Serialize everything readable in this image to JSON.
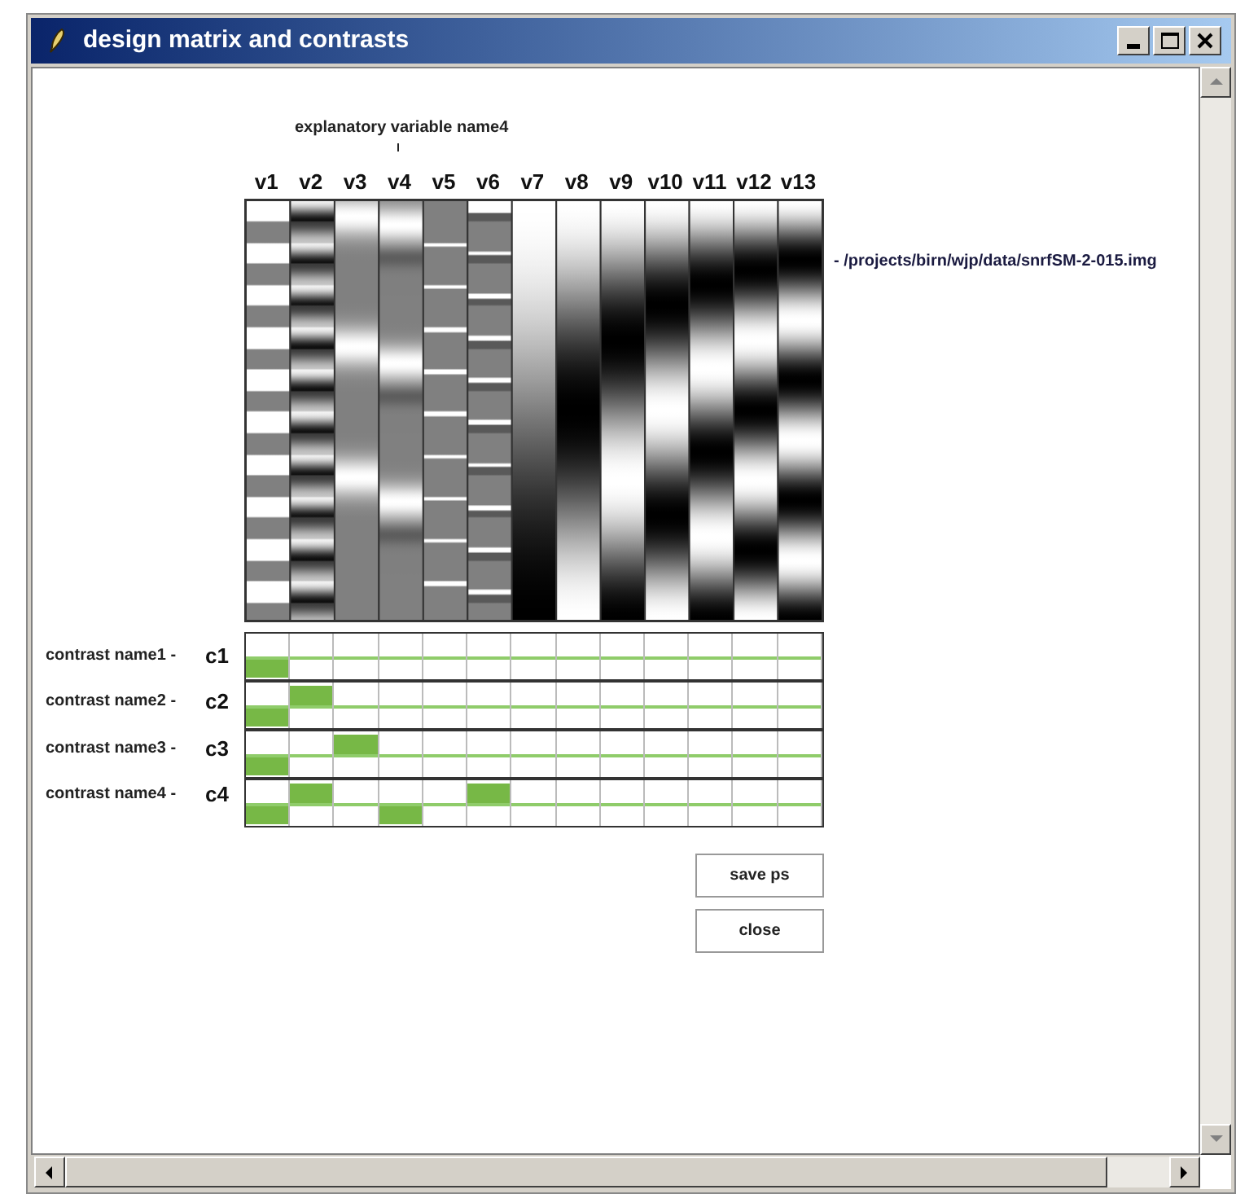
{
  "window": {
    "title": "design matrix and contrasts"
  },
  "explanatory_variable_label": "explanatory variable name4",
  "columns": [
    "v1",
    "v2",
    "v3",
    "v4",
    "v5",
    "v6",
    "v7",
    "v8",
    "v9",
    "v10",
    "v11",
    "v12",
    "v13"
  ],
  "image_label": "- /projects/birn/wjp/data/snrfSM-2-015.img",
  "contrasts": [
    {
      "name": "contrast name1 -",
      "label": "c1",
      "cells": [
        {
          "upper_filled": false,
          "lower_filled": true
        },
        {
          "upper_filled": false,
          "lower_filled": false
        },
        {
          "upper_filled": false,
          "lower_filled": false
        },
        {
          "upper_filled": false,
          "lower_filled": false
        },
        {
          "upper_filled": false,
          "lower_filled": false
        },
        {
          "upper_filled": false,
          "lower_filled": false
        },
        {
          "upper_filled": false,
          "lower_filled": false
        },
        {
          "upper_filled": false,
          "lower_filled": false
        },
        {
          "upper_filled": false,
          "lower_filled": false
        },
        {
          "upper_filled": false,
          "lower_filled": false
        },
        {
          "upper_filled": false,
          "lower_filled": false
        },
        {
          "upper_filled": false,
          "lower_filled": false
        },
        {
          "upper_filled": false,
          "lower_filled": false
        }
      ]
    },
    {
      "name": "contrast name2 -",
      "label": "c2",
      "cells": [
        {
          "upper_filled": false,
          "lower_filled": true
        },
        {
          "upper_filled": true,
          "lower_filled": false
        },
        {
          "upper_filled": false,
          "lower_filled": false
        },
        {
          "upper_filled": false,
          "lower_filled": false
        },
        {
          "upper_filled": false,
          "lower_filled": false
        },
        {
          "upper_filled": false,
          "lower_filled": false
        },
        {
          "upper_filled": false,
          "lower_filled": false
        },
        {
          "upper_filled": false,
          "lower_filled": false
        },
        {
          "upper_filled": false,
          "lower_filled": false
        },
        {
          "upper_filled": false,
          "lower_filled": false
        },
        {
          "upper_filled": false,
          "lower_filled": false
        },
        {
          "upper_filled": false,
          "lower_filled": false
        },
        {
          "upper_filled": false,
          "lower_filled": false
        }
      ]
    },
    {
      "name": "contrast name3 -",
      "label": "c3",
      "cells": [
        {
          "upper_filled": false,
          "lower_filled": true
        },
        {
          "upper_filled": false,
          "lower_filled": false
        },
        {
          "upper_filled": true,
          "lower_filled": false
        },
        {
          "upper_filled": false,
          "lower_filled": false
        },
        {
          "upper_filled": false,
          "lower_filled": false
        },
        {
          "upper_filled": false,
          "lower_filled": false
        },
        {
          "upper_filled": false,
          "lower_filled": false
        },
        {
          "upper_filled": false,
          "lower_filled": false
        },
        {
          "upper_filled": false,
          "lower_filled": false
        },
        {
          "upper_filled": false,
          "lower_filled": false
        },
        {
          "upper_filled": false,
          "lower_filled": false
        },
        {
          "upper_filled": false,
          "lower_filled": false
        },
        {
          "upper_filled": false,
          "lower_filled": false
        }
      ]
    },
    {
      "name": "contrast name4 -",
      "label": "c4",
      "cells": [
        {
          "upper_filled": false,
          "lower_filled": true
        },
        {
          "upper_filled": true,
          "lower_filled": false
        },
        {
          "upper_filled": false,
          "lower_filled": false
        },
        {
          "upper_filled": false,
          "lower_filled": true
        },
        {
          "upper_filled": false,
          "lower_filled": false
        },
        {
          "upper_filled": true,
          "lower_filled": false
        },
        {
          "upper_filled": false,
          "lower_filled": false
        },
        {
          "upper_filled": false,
          "lower_filled": false
        },
        {
          "upper_filled": false,
          "lower_filled": false
        },
        {
          "upper_filled": false,
          "lower_filled": false
        },
        {
          "upper_filled": false,
          "lower_filled": false
        },
        {
          "upper_filled": false,
          "lower_filled": false
        },
        {
          "upper_filled": false,
          "lower_filled": false
        }
      ]
    }
  ],
  "buttons": [
    "save ps",
    "close"
  ]
}
